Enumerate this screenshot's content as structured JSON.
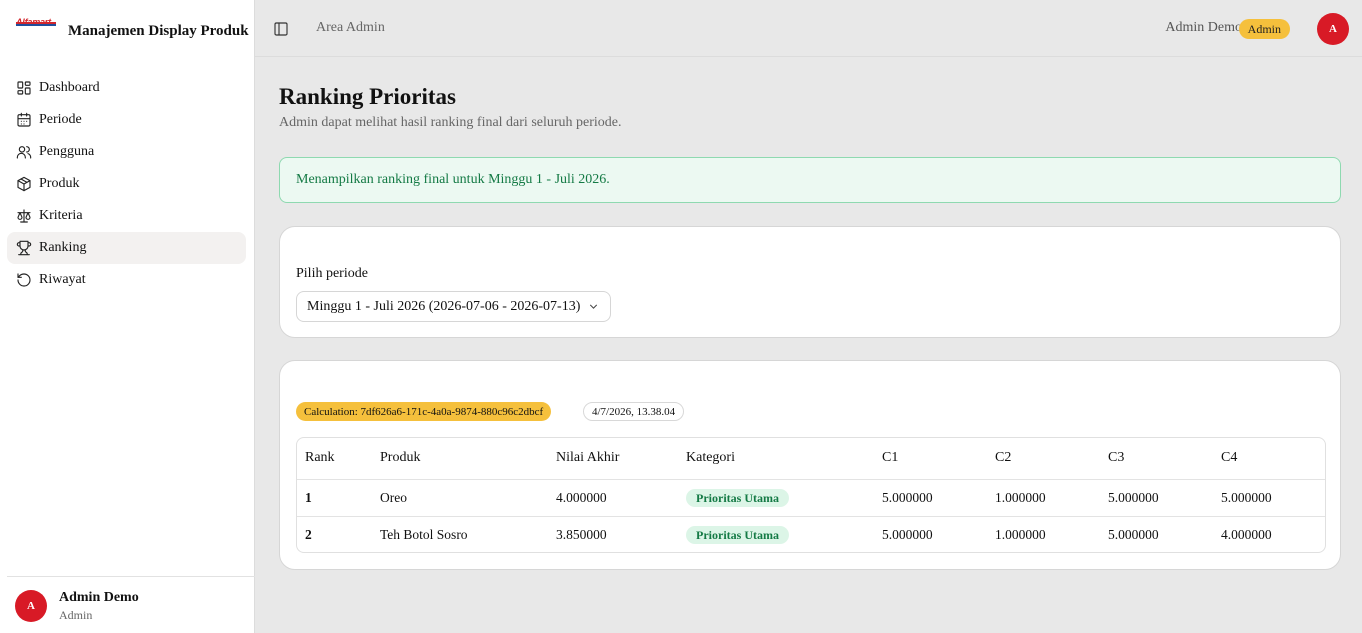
{
  "brand": {
    "logo_text": "Alfamart",
    "title": "Manajemen Display Produk"
  },
  "sidebar": {
    "items": [
      {
        "label": "Dashboard",
        "icon": "dashboard-icon"
      },
      {
        "label": "Periode",
        "icon": "calendar-icon"
      },
      {
        "label": "Pengguna",
        "icon": "users-icon"
      },
      {
        "label": "Produk",
        "icon": "package-icon"
      },
      {
        "label": "Kriteria",
        "icon": "scale-icon"
      },
      {
        "label": "Ranking",
        "icon": "trophy-icon",
        "active": true
      },
      {
        "label": "Riwayat",
        "icon": "history-icon"
      }
    ],
    "footer": {
      "avatar": "A",
      "name": "Admin Demo",
      "role": "Admin"
    }
  },
  "header": {
    "area": "Area Admin",
    "user": "Admin Demo",
    "role_badge": "Admin",
    "avatar": "A"
  },
  "page": {
    "title": "Ranking Prioritas",
    "subtitle": "Admin dapat melihat hasil ranking final dari seluruh periode.",
    "alert": "Menampilkan ranking final untuk Minggu 1 - Juli 2026."
  },
  "filter": {
    "label": "Pilih periode",
    "selected": "Minggu 1 - Juli 2026 (2026-07-06 - 2026-07-13)"
  },
  "result": {
    "calculation": "Calculation: 7df626a6-171c-4a0a-9874-880c96c2dbcf",
    "timestamp": "4/7/2026, 13.38.04",
    "columns": [
      "Rank",
      "Produk",
      "Nilai Akhir",
      "Kategori",
      "C1",
      "C2",
      "C3",
      "C4"
    ],
    "rows": [
      {
        "rank": "1",
        "produk": "Oreo",
        "nilai": "4.000000",
        "kategori": "Prioritas Utama",
        "c1": "5.000000",
        "c2": "1.000000",
        "c3": "5.000000",
        "c4": "5.000000"
      },
      {
        "rank": "2",
        "produk": "Teh Botol Sosro",
        "nilai": "3.850000",
        "kategori": "Prioritas Utama",
        "c1": "5.000000",
        "c2": "1.000000",
        "c3": "5.000000",
        "c4": "4.000000"
      }
    ]
  },
  "colors": {
    "accent_red": "#d81a26",
    "badge_yellow": "#f5c03c",
    "success_green": "#147a45"
  }
}
